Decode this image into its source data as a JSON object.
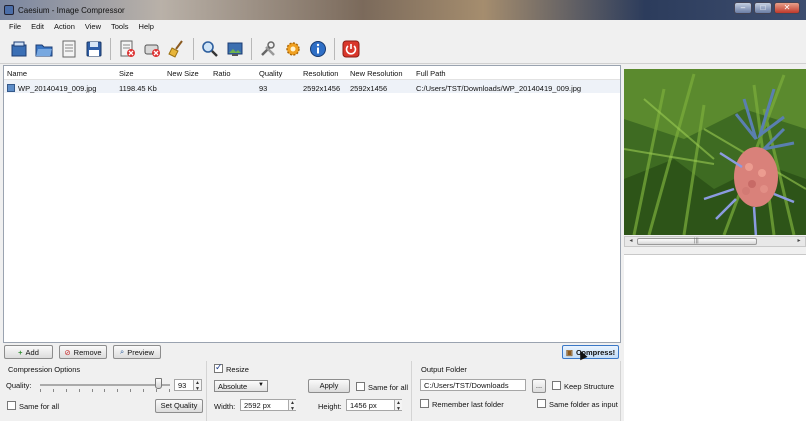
{
  "window": {
    "title": "Caesium - Image Compressor"
  },
  "menu": [
    "File",
    "Edit",
    "Action",
    "View",
    "Tools",
    "Help"
  ],
  "list": {
    "columns": [
      "Name",
      "Size",
      "New Size",
      "Ratio",
      "Quality",
      "Resolution",
      "New Resolution",
      "Full Path"
    ],
    "rows": [
      {
        "name": "WP_20140419_009.jpg",
        "size": "1198.45 Kb",
        "new_size": "",
        "ratio": "",
        "quality": "93",
        "resolution": "2592x1456",
        "new_resolution": "2592x1456",
        "path": "C:/Users/TST/Downloads/WP_20140419_009.jpg"
      }
    ]
  },
  "buttons": {
    "add": "Add",
    "remove": "Remove",
    "preview": "Preview",
    "compress": "Compress!"
  },
  "compression": {
    "title": "Compression Options",
    "quality_label": "Quality:",
    "quality_value": "93",
    "same_for_all": "Same for all",
    "set_quality": "Set Quality"
  },
  "resize": {
    "label": "Resize",
    "checked": true,
    "mode": "Absolute",
    "apply": "Apply",
    "same_for_all": "Same for all",
    "width_label": "Width:",
    "width_value": "2592 px",
    "height_label": "Height:",
    "height_value": "1456 px"
  },
  "output": {
    "title": "Output Folder",
    "path": "C:/Users/TST/Downloads",
    "browse": "...",
    "keep_structure": "Keep Structure",
    "remember_last": "Remember last folder",
    "same_folder": "Same folder as input"
  }
}
